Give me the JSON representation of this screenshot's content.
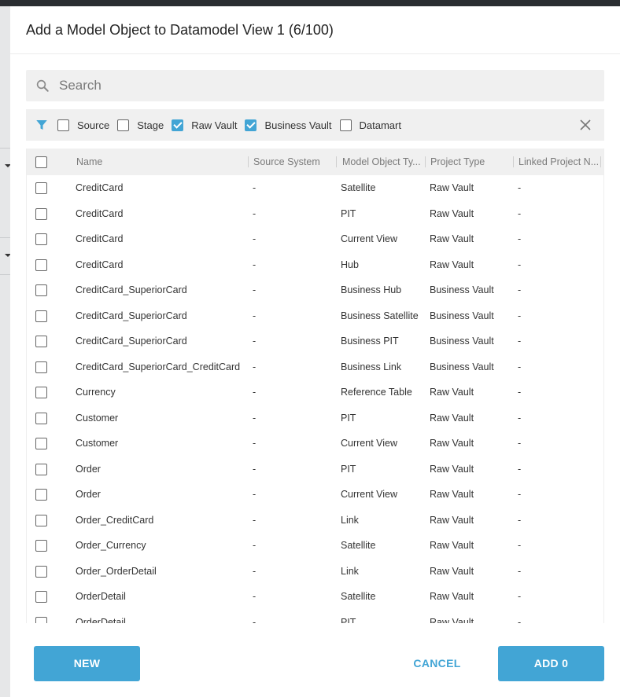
{
  "dialog": {
    "title": "Add a Model Object to Datamodel View 1 (6/100)"
  },
  "search": {
    "placeholder": "Search",
    "value": ""
  },
  "filters": [
    {
      "label": "Source",
      "checked": false
    },
    {
      "label": "Stage",
      "checked": false
    },
    {
      "label": "Raw Vault",
      "checked": true
    },
    {
      "label": "Business Vault",
      "checked": true
    },
    {
      "label": "Datamart",
      "checked": false
    }
  ],
  "table": {
    "columns": [
      "Name",
      "Source System",
      "Model Object Ty...",
      "Project Type",
      "Linked Project N..."
    ],
    "rows": [
      [
        "CreditCard",
        "-",
        "Satellite",
        "Raw Vault",
        "-"
      ],
      [
        "CreditCard",
        "-",
        "PIT",
        "Raw Vault",
        "-"
      ],
      [
        "CreditCard",
        "-",
        "Current View",
        "Raw Vault",
        "-"
      ],
      [
        "CreditCard",
        "-",
        "Hub",
        "Raw Vault",
        "-"
      ],
      [
        "CreditCard_SuperiorCard",
        "-",
        "Business Hub",
        "Business Vault",
        "-"
      ],
      [
        "CreditCard_SuperiorCard",
        "-",
        "Business Satellite",
        "Business Vault",
        "-"
      ],
      [
        "CreditCard_SuperiorCard",
        "-",
        "Business PIT",
        "Business Vault",
        "-"
      ],
      [
        "CreditCard_SuperiorCard_CreditCard",
        "-",
        "Business Link",
        "Business Vault",
        "-"
      ],
      [
        "Currency",
        "-",
        "Reference Table",
        "Raw Vault",
        "-"
      ],
      [
        "Customer",
        "-",
        "PIT",
        "Raw Vault",
        "-"
      ],
      [
        "Customer",
        "-",
        "Current View",
        "Raw Vault",
        "-"
      ],
      [
        "Order",
        "-",
        "PIT",
        "Raw Vault",
        "-"
      ],
      [
        "Order",
        "-",
        "Current View",
        "Raw Vault",
        "-"
      ],
      [
        "Order_CreditCard",
        "-",
        "Link",
        "Raw Vault",
        "-"
      ],
      [
        "Order_Currency",
        "-",
        "Satellite",
        "Raw Vault",
        "-"
      ],
      [
        "Order_OrderDetail",
        "-",
        "Link",
        "Raw Vault",
        "-"
      ],
      [
        "OrderDetail",
        "-",
        "Satellite",
        "Raw Vault",
        "-"
      ],
      [
        "OrderDetail",
        "-",
        "PIT",
        "Raw Vault",
        "-"
      ]
    ]
  },
  "buttons": {
    "new": "NEW",
    "cancel": "CANCEL",
    "add": "ADD 0"
  },
  "colors": {
    "accent": "#42a5d5"
  },
  "icons": {
    "search": "search-icon",
    "filter": "filter-icon",
    "close": "close-icon"
  }
}
